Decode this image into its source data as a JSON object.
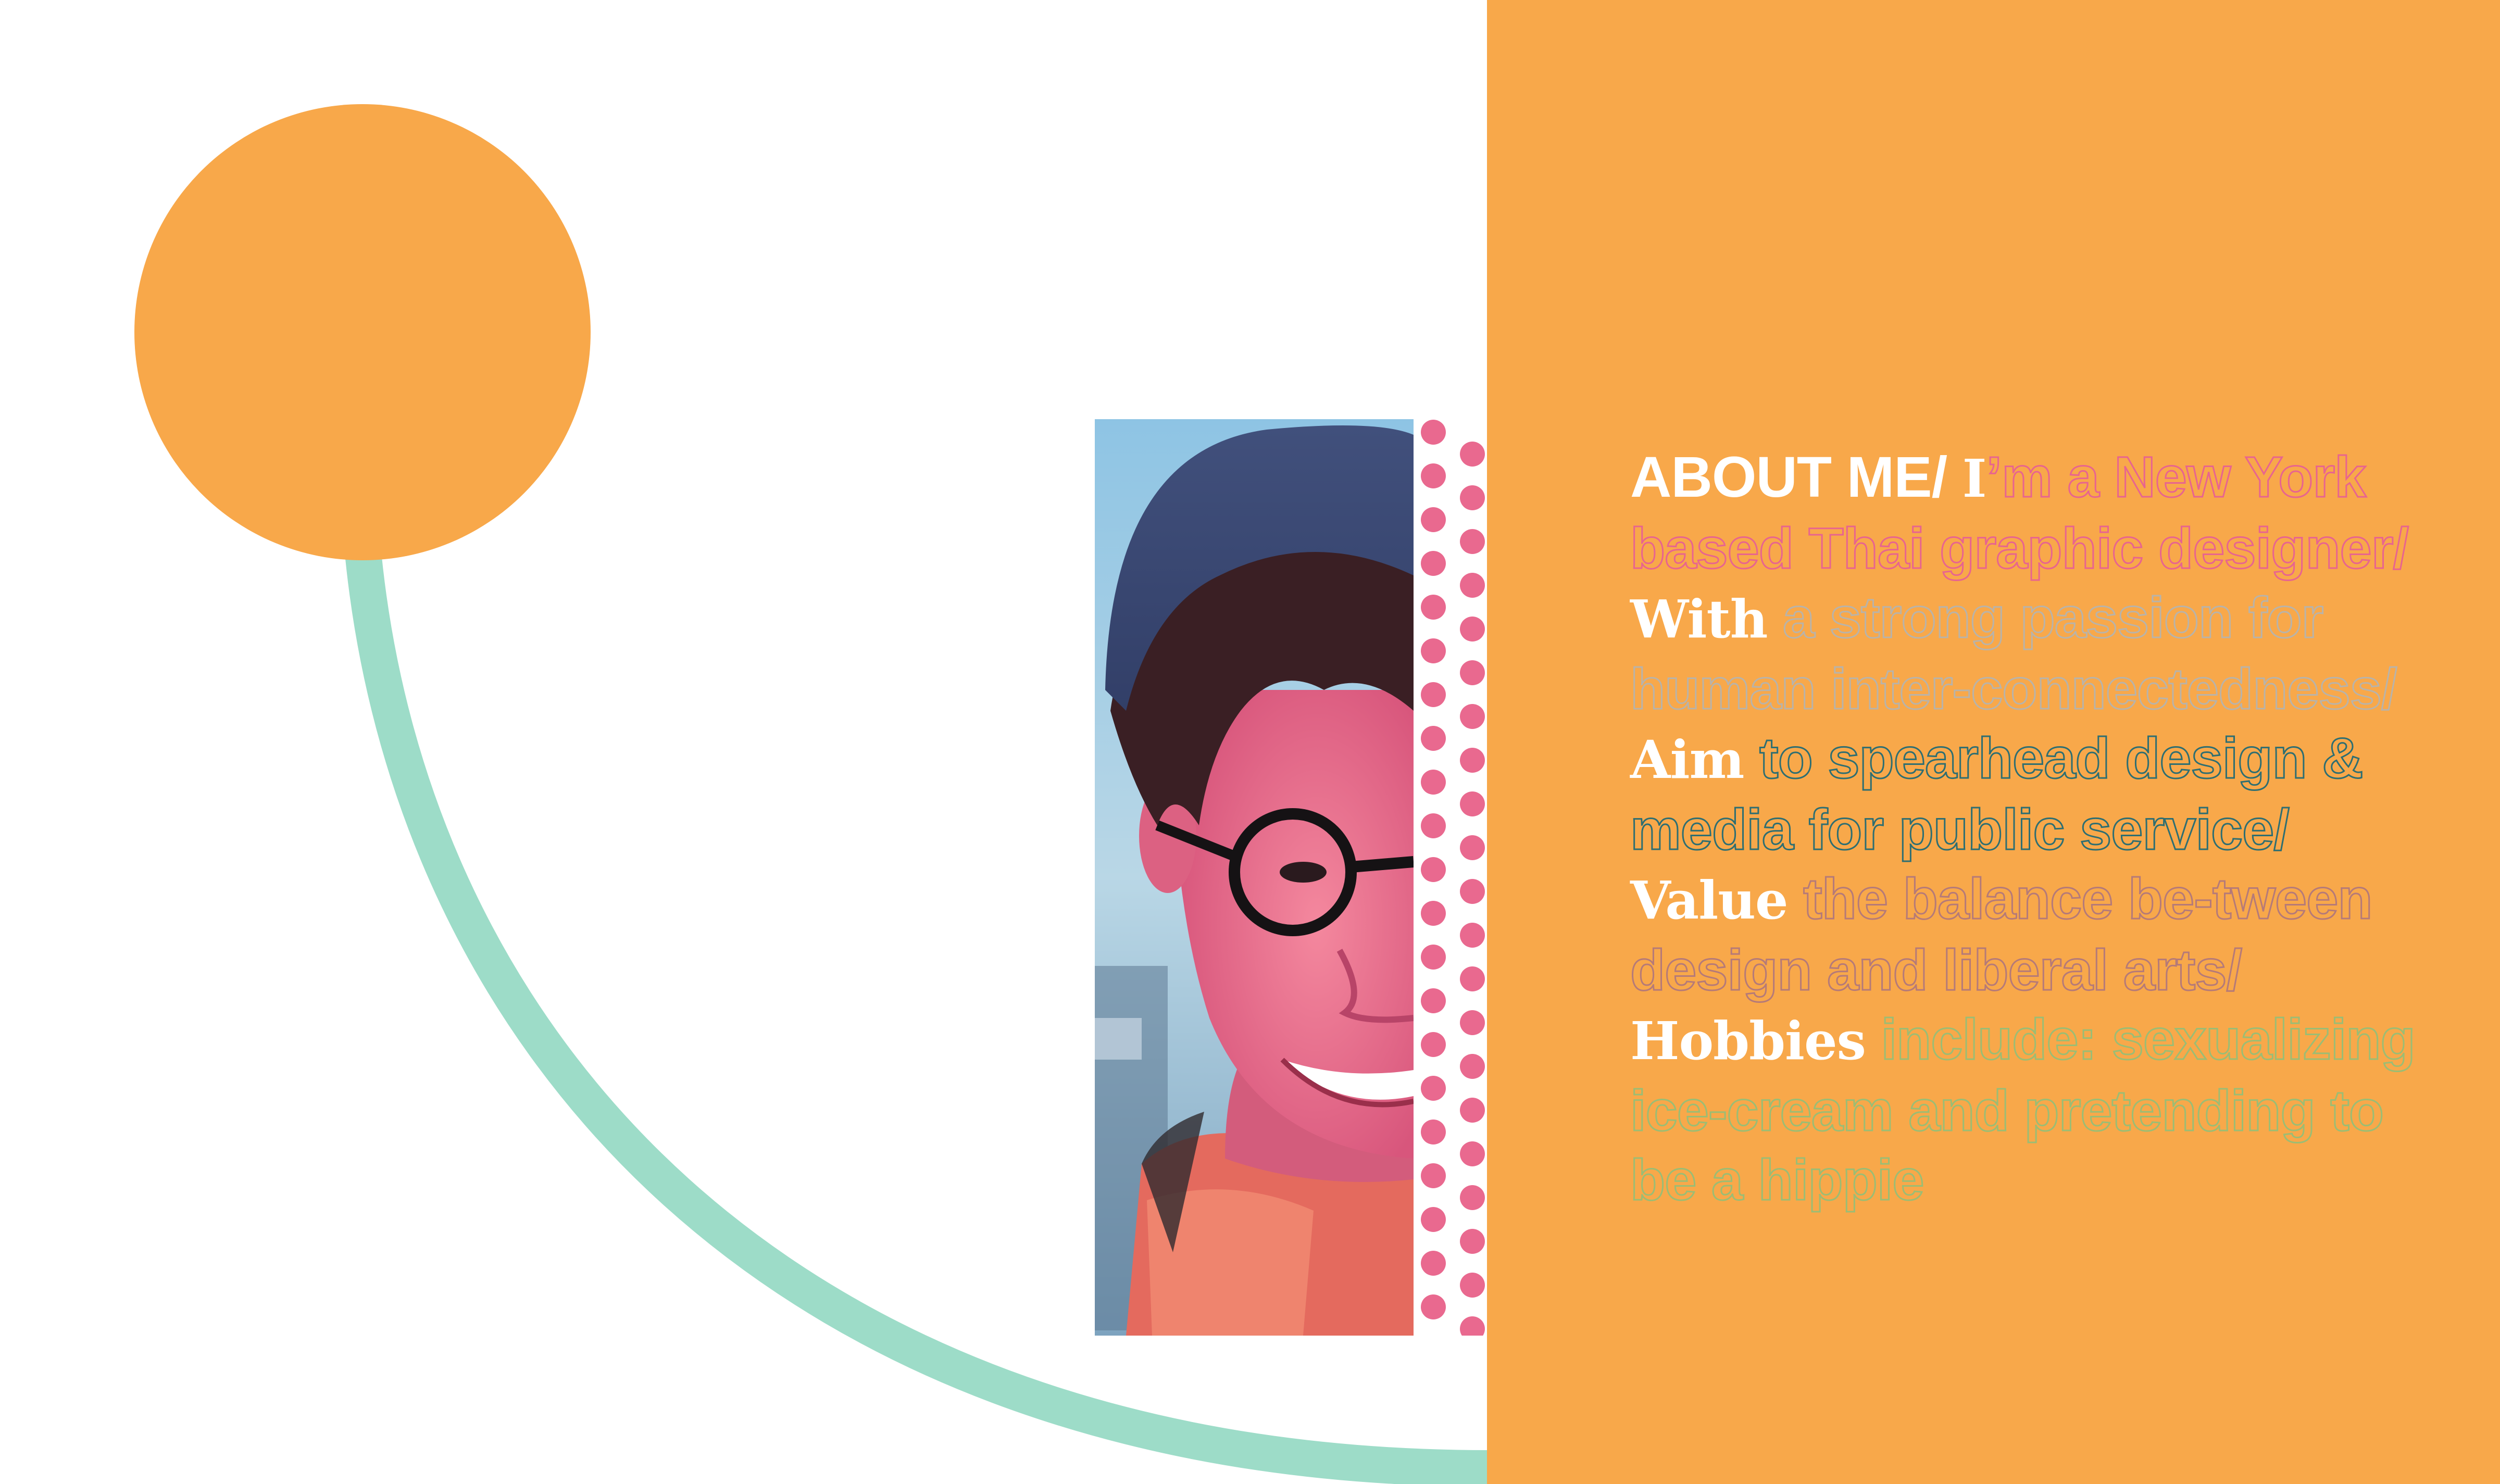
{
  "colors": {
    "background": "#ffffff",
    "orange": "#f8a84a",
    "mint": "#9ddcc8",
    "pink_dots": "#e9698f",
    "pink_text": "#e8648f",
    "grey_text": "#b9b3a9",
    "teal_text": "#2d6e72",
    "mauve_text": "#b57a78",
    "green_text": "#9bbd74"
  },
  "decor": {
    "circle_icon": "orange-circle",
    "arc_icon": "mint-arc",
    "dots_icon": "pink-dot-pattern"
  },
  "photo": {
    "subject_icon": "portrait-photo"
  },
  "about": {
    "heading": "ABOUT ME/",
    "segments": [
      {
        "style": "key",
        "text": "I"
      },
      {
        "style": "outline-pink",
        "text": "’m a New York based Thai graphic designer/ "
      },
      {
        "style": "key",
        "text": "With"
      },
      {
        "style": "outline-grey",
        "text": " a strong passion for human inter-connectedness/ "
      },
      {
        "style": "key",
        "text": "Aim"
      },
      {
        "style": "outline-teal",
        "text": " to spearhead design & media for public service/ "
      },
      {
        "style": "key",
        "text": "Value"
      },
      {
        "style": "outline-mauve",
        "text": " the balance be-tween design and liberal arts/ "
      },
      {
        "style": "key",
        "text": "Hobbies"
      },
      {
        "style": "outline-green",
        "text": " include: sexualizing ice-cream and pretending to be a hippie"
      }
    ]
  }
}
